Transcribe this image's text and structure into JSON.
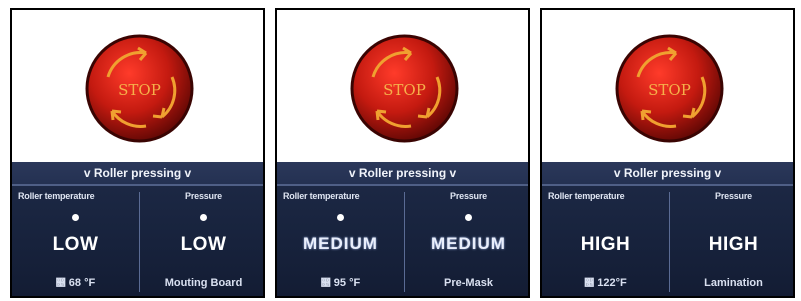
{
  "panels": [
    {
      "stop_label": "STOP",
      "title": "v Roller pressing v",
      "left": {
        "label": "Roller temperature",
        "level": "LOW",
        "heat_icon": "heat-waves-icon",
        "heat_symbol": "෕",
        "temperature": "68 °F"
      },
      "right": {
        "label": "Pressure",
        "level": "LOW",
        "mode": "Mouting Board"
      }
    },
    {
      "stop_label": "STOP",
      "title": "v Roller pressing v",
      "left": {
        "label": "Roller temperature",
        "level": "MEDIUM",
        "heat_icon": "heat-waves-icon",
        "heat_symbol": "෕",
        "temperature": "95 °F"
      },
      "right": {
        "label": "Pressure",
        "level": "MEDIUM",
        "mode": "Pre-Mask"
      }
    },
    {
      "stop_label": "STOP",
      "title": "v Roller pressing v",
      "left": {
        "label": "Roller temperature",
        "level": "HIGH",
        "heat_icon": "heat-waves-icon",
        "heat_symbol": "෕",
        "temperature": "122°F"
      },
      "right": {
        "label": "Pressure",
        "level": "HIGH",
        "mode": "Lamination"
      }
    }
  ],
  "colors": {
    "stop_red": "#c41a10",
    "stop_ring": "#7a0a05",
    "arrow_orange": "#f0a030",
    "screen_bg": "#17223c",
    "title_bg": "#2b385a"
  }
}
